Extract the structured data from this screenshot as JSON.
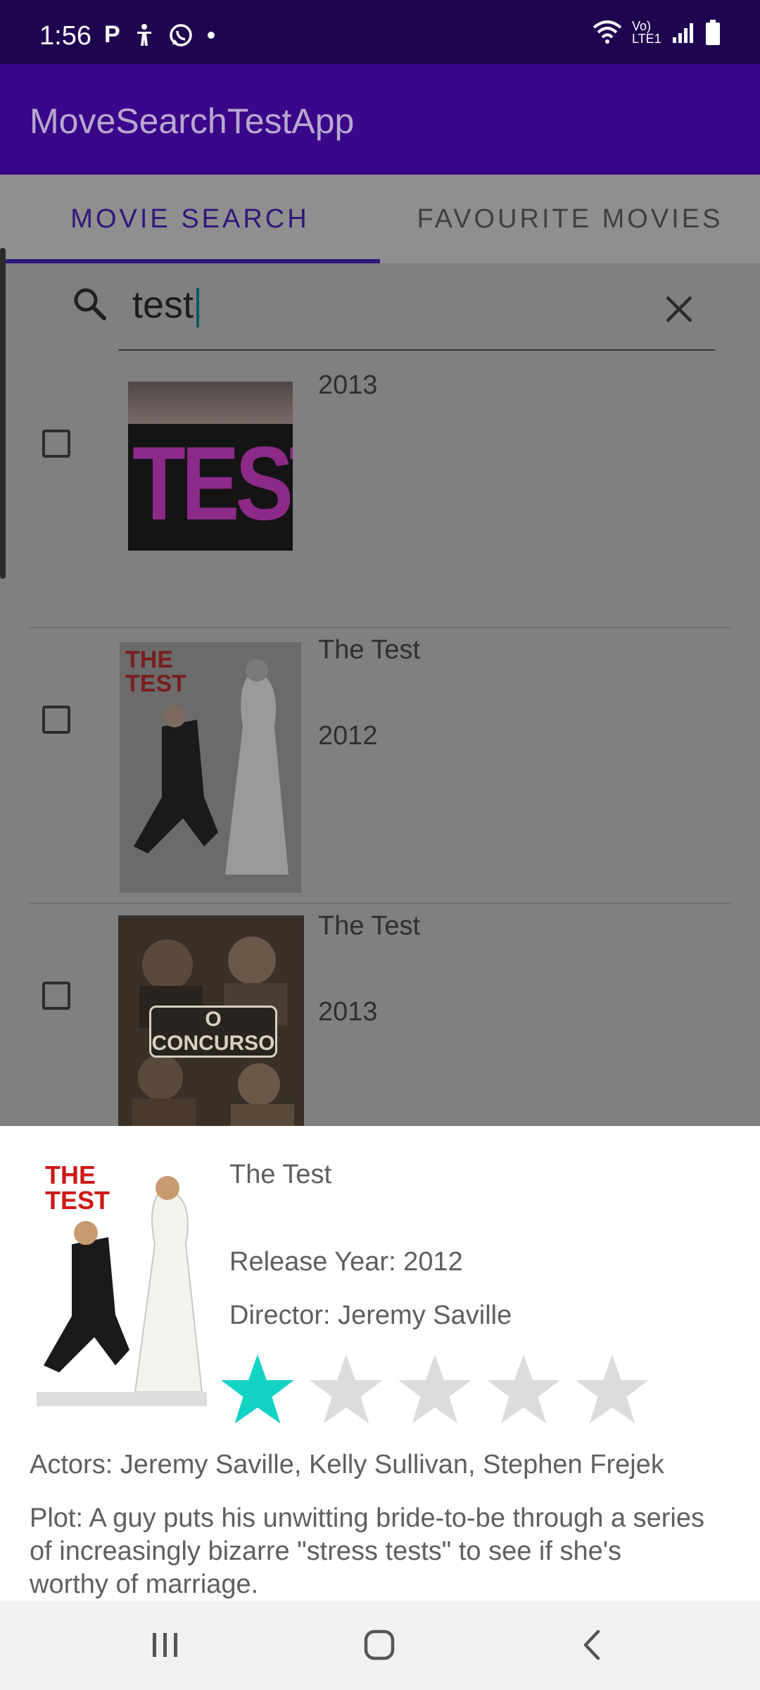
{
  "status_bar": {
    "time": "1:56",
    "notification_icons": [
      "p-app-icon",
      "accessibility-icon",
      "whatsapp-icon",
      "dot-icon"
    ],
    "notif_p": "P",
    "network": "Vo) LTE1"
  },
  "app": {
    "title": "MoveSearchTestApp"
  },
  "tabs": [
    {
      "label": "MOVIE SEARCH",
      "selected": true
    },
    {
      "label": "FAVOURITE MOVIES",
      "selected": false
    }
  ],
  "search": {
    "value": "test"
  },
  "results": [
    {
      "title": "",
      "year": "2013",
      "checked": false,
      "poster_text": "TEST"
    },
    {
      "title": "The Test",
      "year": "2012",
      "checked": false,
      "poster_text": "THE TEST"
    },
    {
      "title": "The Test",
      "year": "2013",
      "checked": false,
      "poster_text": "O CONCURSO"
    }
  ],
  "details": {
    "title": "The Test",
    "release_year": "Release Year: 2012",
    "director": "Director: Jeremy Saville",
    "rating": 1,
    "rating_max": 5,
    "actors": "Actors: Jeremy Saville, Kelly Sullivan, Stephen Frejek",
    "plot": "Plot: A guy puts his unwitting bride-to-be through a series of increasingly bizarre \"stress tests\" to see if she's worthy of marriage.",
    "poster_text": "THE TEST"
  },
  "colors": {
    "status_bar": "#1f0550",
    "app_bar": "#3a068a",
    "accent": "#31167a",
    "star_filled": "#13d3c5",
    "star_empty": "#dcdcdc",
    "scrim": "#808080"
  },
  "nav": [
    "recents-icon",
    "home-icon",
    "back-icon"
  ]
}
